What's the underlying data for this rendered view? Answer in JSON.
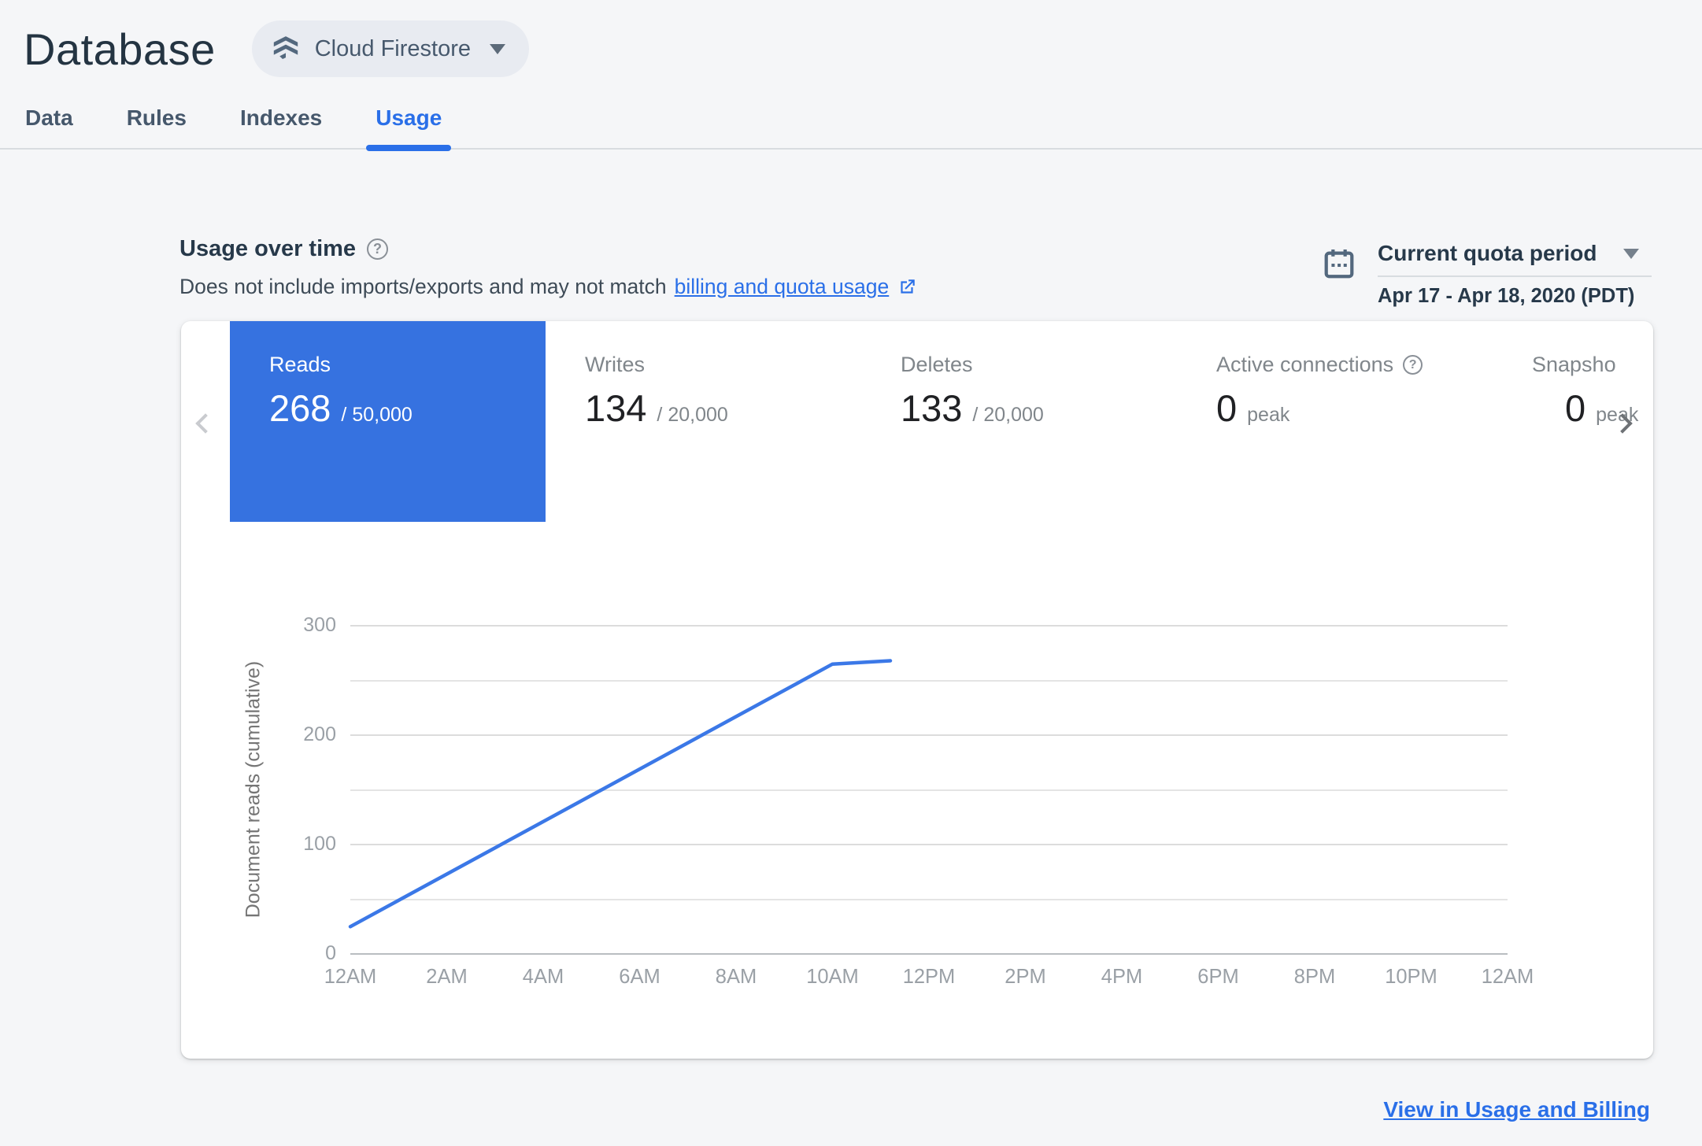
{
  "header": {
    "title": "Database",
    "product_selector": {
      "label": "Cloud Firestore"
    }
  },
  "tabs": [
    {
      "label": "Data",
      "active": false
    },
    {
      "label": "Rules",
      "active": false
    },
    {
      "label": "Indexes",
      "active": false
    },
    {
      "label": "Usage",
      "active": true
    }
  ],
  "usage_section": {
    "title": "Usage over time",
    "subtitle_prefix": "Does not include imports/exports and may not match",
    "subtitle_link": "billing and quota usage",
    "quota_period": {
      "label": "Current quota period",
      "range": "Apr 17 - Apr 18, 2020 (PDT)"
    }
  },
  "metric_cards": [
    {
      "label": "Reads",
      "value": "268",
      "suffix": "/ 50,000",
      "selected": true
    },
    {
      "label": "Writes",
      "value": "134",
      "suffix": "/ 20,000",
      "selected": false
    },
    {
      "label": "Deletes",
      "value": "133",
      "suffix": "/ 20,000",
      "selected": false
    },
    {
      "label": "Active connections",
      "value": "0",
      "suffix": "peak",
      "selected": false,
      "has_help": true
    },
    {
      "label": "Snapsho",
      "value": "0",
      "suffix": "peak",
      "selected": false,
      "clipped": true
    }
  ],
  "chart_data": {
    "type": "line",
    "title": "",
    "xlabel": "",
    "ylabel": "Document reads (cumulative)",
    "x_tick_labels": [
      "12AM",
      "2AM",
      "4AM",
      "6AM",
      "8AM",
      "10AM",
      "12PM",
      "2PM",
      "4PM",
      "6PM",
      "8PM",
      "10PM",
      "12AM"
    ],
    "x_range_hours": [
      0,
      24
    ],
    "ylim": [
      0,
      300
    ],
    "y_major_ticks": [
      0,
      100,
      200,
      300
    ],
    "y_gridline_step": 50,
    "grid": true,
    "legend": "none",
    "series": [
      {
        "name": "Document reads (cumulative)",
        "color": "#3b78e7",
        "points_hour_value": [
          [
            0,
            25
          ],
          [
            10,
            265
          ],
          [
            11.2,
            268
          ]
        ]
      }
    ]
  },
  "footer": {
    "link_label": "View in Usage and Billing"
  },
  "colors": {
    "page_background": "#f5f6f8",
    "panel_background": "#ffffff",
    "accent_blue": "#2a6fe8",
    "selected_card_blue": "#3672e0",
    "chart_line_blue": "#3b78e7",
    "title_text": "#243442",
    "muted_label": "#80868b",
    "tick_gray": "#9aa0a6"
  }
}
